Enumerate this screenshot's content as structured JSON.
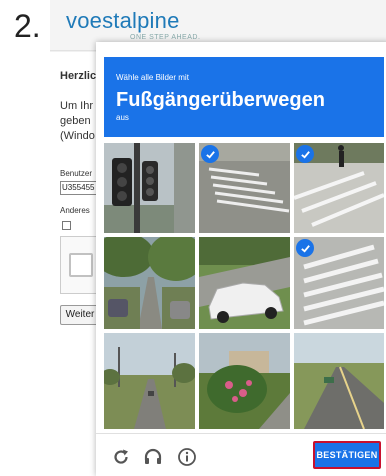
{
  "step_number": "2.",
  "brand": {
    "logo": "voestalpine",
    "tagline": "ONE STEP AHEAD."
  },
  "background_page": {
    "heading": "Herzlic",
    "lines": [
      "Um Ihr",
      "geben ",
      "(Windo"
    ],
    "username_label": "Benutzer",
    "username_value": "U355455",
    "other_label": "Anderes",
    "submit_label": "Weiter"
  },
  "challenge": {
    "instruction_top": "Wähle alle Bilder mit",
    "target_object": "Fußgängerüberwegen",
    "instruction_bottom": "aus",
    "tiles": [
      {
        "id": 1,
        "selected": false,
        "content": "traffic-light"
      },
      {
        "id": 2,
        "selected": true,
        "content": "crosswalk"
      },
      {
        "id": 3,
        "selected": true,
        "content": "crosswalk-with-pedestrian"
      },
      {
        "id": 4,
        "selected": false,
        "content": "tree-lined-street"
      },
      {
        "id": 5,
        "selected": false,
        "content": "white-car"
      },
      {
        "id": 6,
        "selected": true,
        "content": "crosswalk"
      },
      {
        "id": 7,
        "selected": false,
        "content": "road-with-trees"
      },
      {
        "id": 8,
        "selected": false,
        "content": "flowering-tree"
      },
      {
        "id": 9,
        "selected": false,
        "content": "highway"
      }
    ],
    "footer": {
      "reload_icon": "reload-icon",
      "audio_icon": "headphones-icon",
      "info_icon": "info-icon",
      "verify_label": "BESTÄTIGEN"
    }
  },
  "colors": {
    "accent": "#1a73e8",
    "highlight_border": "#c8102e",
    "brand": "#1f7ab8"
  }
}
